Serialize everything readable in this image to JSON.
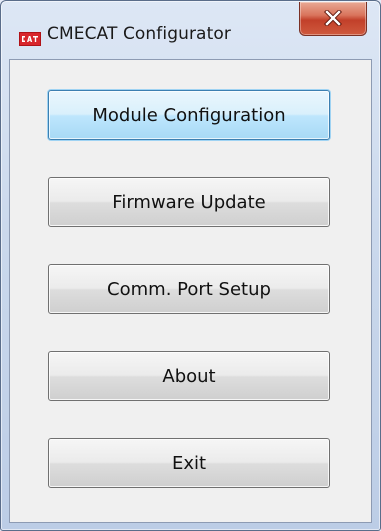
{
  "window": {
    "title": "CMECAT Configurator",
    "app_icon": "cmecat-logo-icon",
    "close_icon": "close-icon"
  },
  "buttons": [
    {
      "label": "Module Configuration",
      "focused": true
    },
    {
      "label": "Firmware Update",
      "focused": false
    },
    {
      "label": "Comm. Port Setup",
      "focused": false
    },
    {
      "label": "About",
      "focused": false
    },
    {
      "label": "Exit",
      "focused": false
    }
  ],
  "colors": {
    "close_button": "#c2402a",
    "focus_accent": "#3c7fb1",
    "app_icon": "#d8262c"
  }
}
